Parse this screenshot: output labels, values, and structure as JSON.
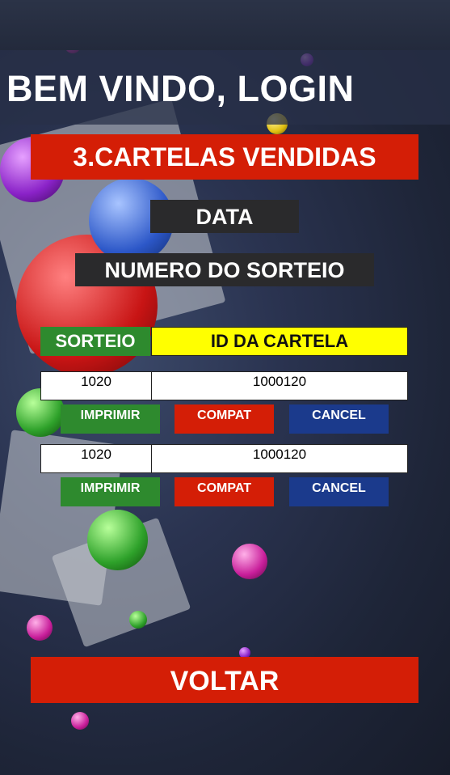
{
  "header": {
    "title": "BEM VINDO, LOGIN"
  },
  "section_title": "3.CARTELAS VENDIDAS",
  "filters": {
    "data_label": "DATA",
    "numero_label": "NUMERO DO SORTEIO"
  },
  "table": {
    "columns": [
      "SORTEIO",
      "ID DA CARTELA"
    ],
    "rows": [
      {
        "sorteio": "1020",
        "id_cartela": "1000120"
      },
      {
        "sorteio": "1020",
        "id_cartela": "1000120"
      }
    ]
  },
  "actions": {
    "imprimir": "IMPRIMIR",
    "compat": "COMPAT",
    "cancel": "CANCEL"
  },
  "footer": {
    "voltar": "VOLTAR"
  },
  "colors": {
    "red": "#d41e06",
    "green": "#2e8a2e",
    "blue": "#1b3a8c",
    "yellow": "#ffff00",
    "dark": "#2a2a2c"
  }
}
